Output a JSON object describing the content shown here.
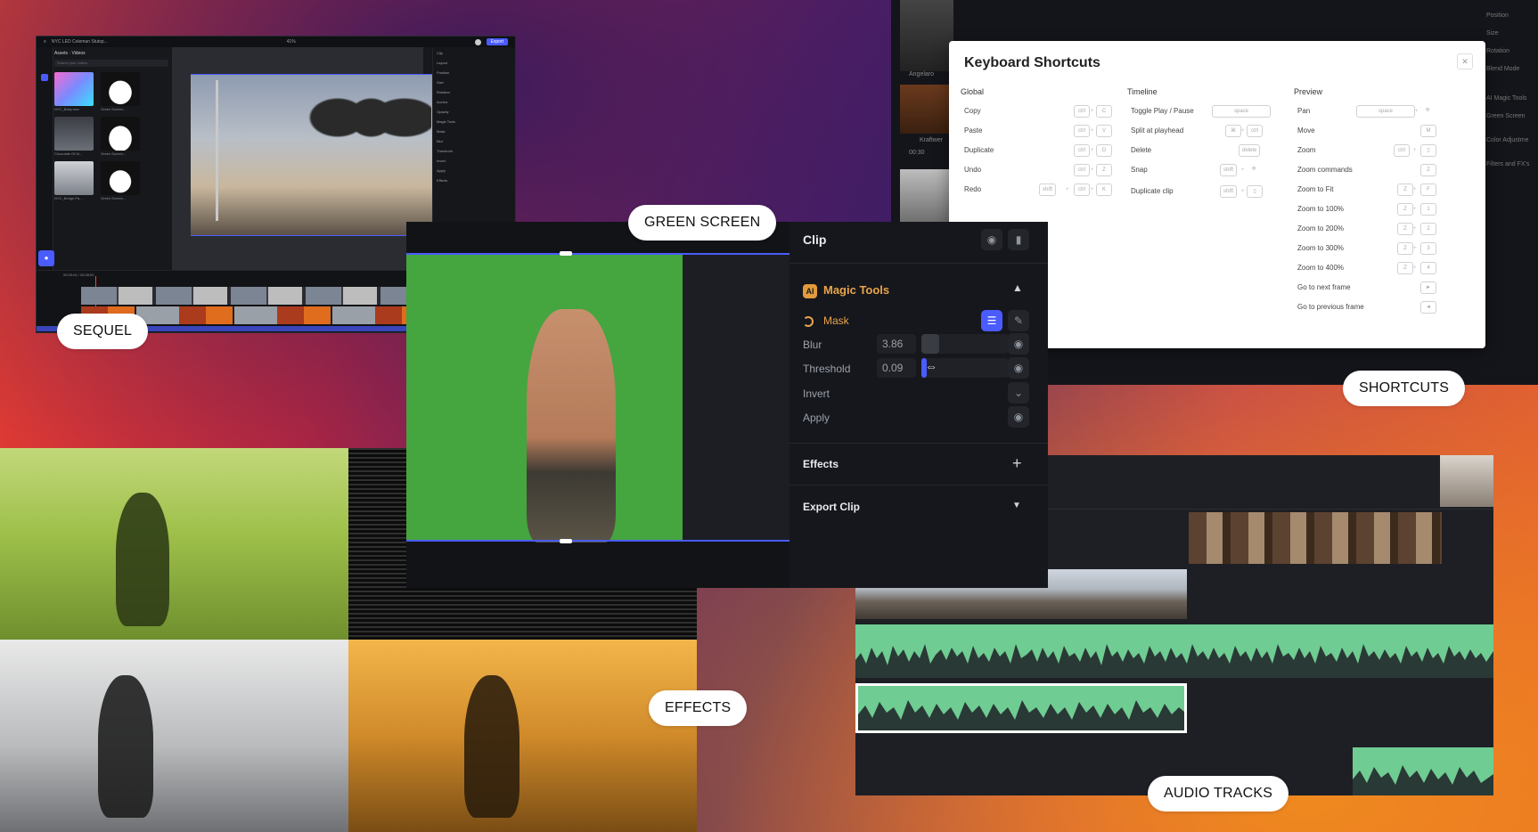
{
  "colors": {
    "accent": "#4a5bff",
    "green_screen": "#45a53f",
    "waveform": "#6fcc92",
    "panel_bg": "#16171c",
    "pill_bg": "#ffffff"
  },
  "labels": {
    "sequel": "SEQUEL",
    "green_screen": "GREEN SCREEN",
    "shortcuts": "SHORTCUTS",
    "effects": "EFFECTS",
    "audio_tracks": "AUDIO TRACKS"
  },
  "sequel": {
    "title": "NYC LED Coleman Stutsp...",
    "zoom": "41%",
    "export": "Export",
    "assets_header": "Assets · Videos",
    "search_placeholder": "Search your videos",
    "thumbs": [
      "NYC_Baby.mov",
      "Green Screen...",
      "Chocolate Of M...",
      "Green Screen...",
      "NYC_Bridge.Pa...",
      "Green Screen..."
    ],
    "timecode": "00:05:04 / 00:08:00",
    "right_panel": [
      "Clip",
      "Layout",
      "Position",
      "Size",
      "Rotation",
      "Anchor",
      "Opacity",
      "Magic Tools",
      "Mask",
      "Blur",
      "Threshold",
      "Invert",
      "Apply",
      "Effects"
    ]
  },
  "clip_panel": {
    "title": "Clip",
    "magic_tools": "Magic Tools",
    "ai_badge": "AI",
    "mask": "Mask",
    "blur_label": "Blur",
    "blur_value": "3.86",
    "blur_level": 0.2,
    "threshold_label": "Threshold",
    "threshold_value": "0.09",
    "threshold_level": 0.06,
    "invert": "Invert",
    "apply": "Apply",
    "effects": "Effects",
    "export_clip": "Export Clip"
  },
  "shortcuts": {
    "title": "Keyboard Shortcuts",
    "columns": [
      {
        "heading": "Global",
        "rows": [
          {
            "label": "Copy",
            "keys": [
              "ctrl",
              "C"
            ]
          },
          {
            "label": "Paste",
            "keys": [
              "ctrl",
              "V"
            ]
          },
          {
            "label": "Duplicate",
            "keys": [
              "ctrl",
              "D"
            ]
          },
          {
            "label": "Undo",
            "keys": [
              "ctrl",
              "Z"
            ]
          },
          {
            "label": "Redo",
            "keys": [
              "shift",
              "ctrl",
              "K"
            ]
          }
        ]
      },
      {
        "heading": "Timeline",
        "rows": [
          {
            "label": "Toggle Play / Pause",
            "keys": [
              "space"
            ]
          },
          {
            "label": "Split at playhead",
            "keys": [
              "⌘",
              "ctrl"
            ]
          },
          {
            "label": "Delete",
            "keys": [
              "delete"
            ]
          },
          {
            "label": "Snap",
            "keys": [
              "shift",
              "✣"
            ]
          },
          {
            "label": "Duplicate clip",
            "keys": [
              "shift",
              "▯"
            ]
          }
        ]
      },
      {
        "heading": "Preview",
        "rows": [
          {
            "label": "Pan",
            "keys": [
              "space",
              "✣"
            ]
          },
          {
            "label": "Move",
            "keys": [
              "M"
            ]
          },
          {
            "label": "Zoom",
            "keys": [
              "ctrl",
              "▯"
            ]
          },
          {
            "label": "Zoom commands",
            "keys": [
              "Z"
            ]
          },
          {
            "label": "Zoom to Fit",
            "keys": [
              "Z",
              "F"
            ]
          },
          {
            "label": "Zoom to 100%",
            "keys": [
              "Z",
              "1"
            ]
          },
          {
            "label": "Zoom to 200%",
            "keys": [
              "Z",
              "2"
            ]
          },
          {
            "label": "Zoom to 300%",
            "keys": [
              "Z",
              "3"
            ]
          },
          {
            "label": "Zoom to 400%",
            "keys": [
              "Z",
              "4"
            ]
          },
          {
            "label": "Go to next frame",
            "keys": [
              "►"
            ]
          },
          {
            "label": "Go to previous frame",
            "keys": [
              "◄"
            ]
          }
        ]
      }
    ],
    "side_labels": [
      "Position",
      "Size",
      "Rotation",
      "Blend Mode",
      "AI Magic Tools",
      "Green Screen",
      "Color Adjustme",
      "Filters and FX's"
    ],
    "bg_labels": [
      "Angelaro",
      "Kraftwer",
      "00:30"
    ]
  }
}
